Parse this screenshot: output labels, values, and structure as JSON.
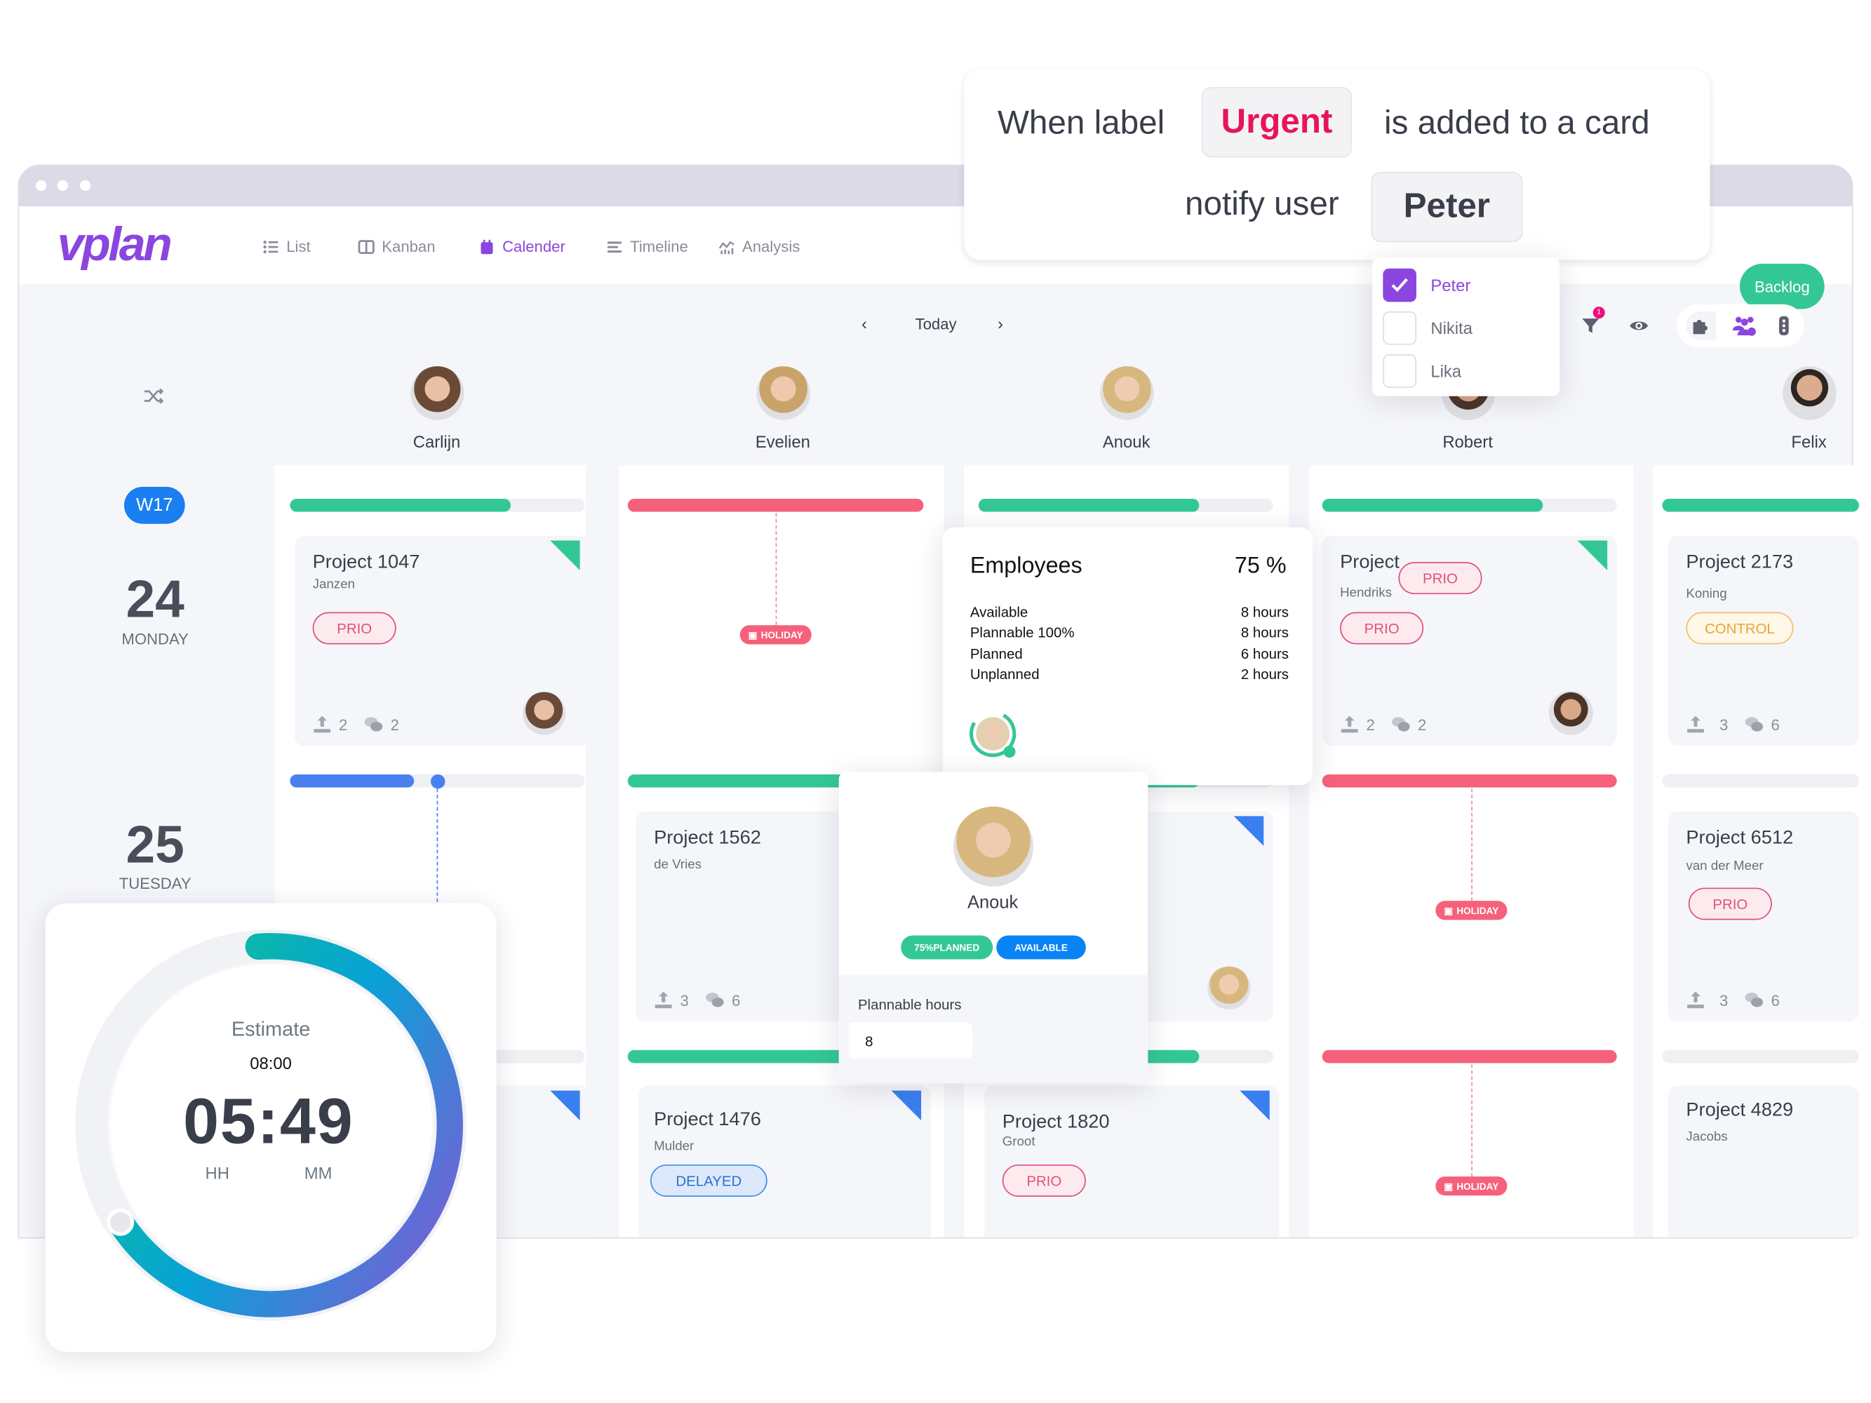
{
  "app": {
    "logo": "vplan",
    "window_dots": 3
  },
  "nav": [
    {
      "label": "List",
      "icon": "list-icon"
    },
    {
      "label": "Kanban",
      "icon": "kanban-icon"
    },
    {
      "label": "Calender",
      "icon": "calendar-icon",
      "active": true
    },
    {
      "label": "Timeline",
      "icon": "timeline-icon"
    },
    {
      "label": "Analysis",
      "icon": "analysis-icon"
    }
  ],
  "backlog_label": "Backlog",
  "automation": {
    "when": "When label",
    "label": "Urgent",
    "suffix": "is added to a card",
    "notify": "notify user",
    "user": "Peter"
  },
  "user_dropdown": [
    {
      "name": "Peter",
      "checked": true
    },
    {
      "name": "Nikita",
      "checked": false
    },
    {
      "name": "Lika",
      "checked": false
    }
  ],
  "date_nav": {
    "prev_icon": "chevron-left-icon",
    "today": "Today",
    "next_icon": "chevron-right-icon"
  },
  "toolbar": {
    "filter_badge": "1",
    "icons": [
      "filter-icon",
      "eye-icon",
      "puzzle-icon",
      "users-cog-icon",
      "more-vertical-icon"
    ]
  },
  "week": "W17",
  "days": [
    {
      "num": "24",
      "name": "MONDAY"
    },
    {
      "num": "25",
      "name": "TUESDAY"
    }
  ],
  "employees": [
    "Carlijn",
    "Evelien",
    "Anouk",
    "Robert",
    "Felix"
  ],
  "capacity": {
    "monday": [
      0.75,
      1.0,
      0.75,
      0.75,
      1.0
    ],
    "tuesday": [
      0.42,
      0.75,
      0.75,
      1.0,
      0
    ],
    "wednesday": [
      0.3,
      0.75,
      0.75,
      1.0,
      0
    ]
  },
  "colors": {
    "green": "#34c796",
    "red": "#f5617a",
    "blue": "#4a80f0",
    "purple": "#8b46e0",
    "urgent": "#e8145a"
  },
  "holiday_label": "HOLIDAY",
  "cards": {
    "p1047": {
      "title": "Project 1047",
      "client": "Janzen",
      "tag": "PRIO",
      "uploads": "2",
      "comments": "2"
    },
    "probert": {
      "title": "Project",
      "client": "Hendriks",
      "tag": "PRIO",
      "drag_tag": "PRIO",
      "uploads": "2",
      "comments": "2"
    },
    "p2173": {
      "title": "Project 2173",
      "client": "Koning",
      "tag": "CONTROL",
      "uploads": "3",
      "comments": "6"
    },
    "p1562": {
      "title": "Project 1562",
      "client": "de Vries",
      "uploads": "3",
      "comments": "6"
    },
    "p6512": {
      "title": "Project 6512",
      "client": "van der Meer",
      "tag": "PRIO",
      "uploads": "3",
      "comments": "6"
    },
    "p1476": {
      "title": "Project 1476",
      "client": "Mulder",
      "tag": "DELAYED"
    },
    "p1820": {
      "title": "Project 1820",
      "client": "Groot",
      "tag": "PRIO"
    },
    "p4829": {
      "title": "Project 4829",
      "client": "Jacobs"
    }
  },
  "employee_popup": {
    "title": "Employees",
    "percent": "75 %",
    "ring_fraction": 0.75,
    "rows": [
      {
        "label": "Available",
        "value": "8 hours"
      },
      {
        "label": "Plannable 100%",
        "value": "8 hours"
      },
      {
        "label": "Planned",
        "value": "6 hours"
      },
      {
        "label": "Unplanned",
        "value": "2 hours"
      }
    ]
  },
  "profile_popup": {
    "name": "Anouk",
    "badge_planned": "75%PLANNED",
    "badge_available": "AVAILABLE",
    "field_label": "Plannable hours",
    "field_value": "8"
  },
  "timer": {
    "label": "Estimate",
    "estimate": "08:00",
    "time": "05:49",
    "hh": "HH",
    "mm": "MM",
    "progress": 0.67
  }
}
